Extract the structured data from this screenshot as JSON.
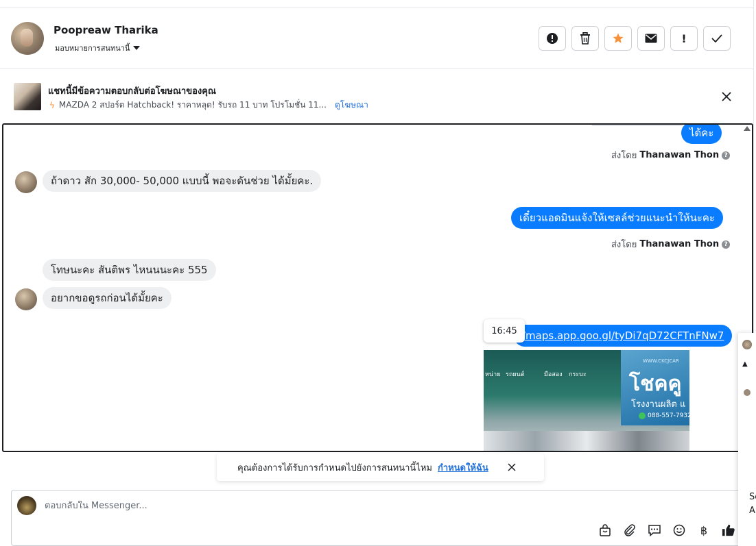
{
  "contact": {
    "name": "Poopreaw Tharika",
    "assign_label": "มอบหมายการสนทนานี้"
  },
  "actions": [
    {
      "icon": "!",
      "name": "report"
    },
    {
      "icon": "🗑",
      "name": "delete"
    },
    {
      "icon": "★",
      "name": "star",
      "color": "#f7923a"
    },
    {
      "icon": "✉",
      "name": "mark-unread"
    },
    {
      "icon": "!",
      "name": "spam"
    },
    {
      "icon": "✓",
      "name": "done"
    }
  ],
  "ad": {
    "title": "แชทนี้มีข้อความตอบกลับต่อโฆษณาของคุณ",
    "description": "MAZDA 2 สปอร์ต Hatchback! ราคาหลุด! รับรถ 11 บาท โปรโมชั่น 11...",
    "link": "ดูโฆษณา"
  },
  "messages": [
    {
      "text": "ได้คะ"
    },
    {
      "sent_by_prefix": "ส่งโดย",
      "sent_by_name": "Thanawan Thon"
    },
    {
      "text": "ถ้าดาว สัก 30,000- 50,000 แบบนี้ พอจะดันช่วย ได้มั้ยคะ."
    },
    {
      "text": "เดี๋ยวแอดมินแจ้งให้เซลล์ช่วยแนะนำให้นะคะ"
    },
    {
      "sent_by_prefix": "ส่งโดย",
      "sent_by_name": "Thanawan Thon"
    },
    {
      "text": "โทษนะคะ สันติพร ไหนนนะคะ 555"
    },
    {
      "text": "อยากขอดูรถก่อนได้มั้ยคะ"
    },
    {
      "text": "/maps.app.goo.gl/tyDi7qD72CFTnFNw7"
    }
  ],
  "tooltip_time": "16:45",
  "link_preview": {
    "website": "WWW.CKCJCAR",
    "title": "โชคคู",
    "subtitle": "โรงงานผลิต แ",
    "phone": "088-557-7932",
    "shop_labels": [
      "หน่าย",
      "รถยนต์",
      "มือสอง",
      "กระบะ"
    ]
  },
  "suggestion": {
    "text": "คุณต้องการได้รับการกำหนดไปยังการสนทนานี้ไหม",
    "link": "กำหนดให้ฉัน"
  },
  "composer": {
    "placeholder": "ตอบกลับใน Messenger..."
  },
  "tools": [
    "bag",
    "paperclip",
    "chat-bubbles",
    "smiley",
    "baht",
    "thumbs-up"
  ],
  "peek_panel": {
    "line1": "Sc",
    "line2": "A"
  },
  "colors": {
    "outgoing_bubble": "#0a7cff",
    "incoming_bubble": "#eeeff1",
    "link": "#216fdb",
    "star": "#f7923a"
  }
}
